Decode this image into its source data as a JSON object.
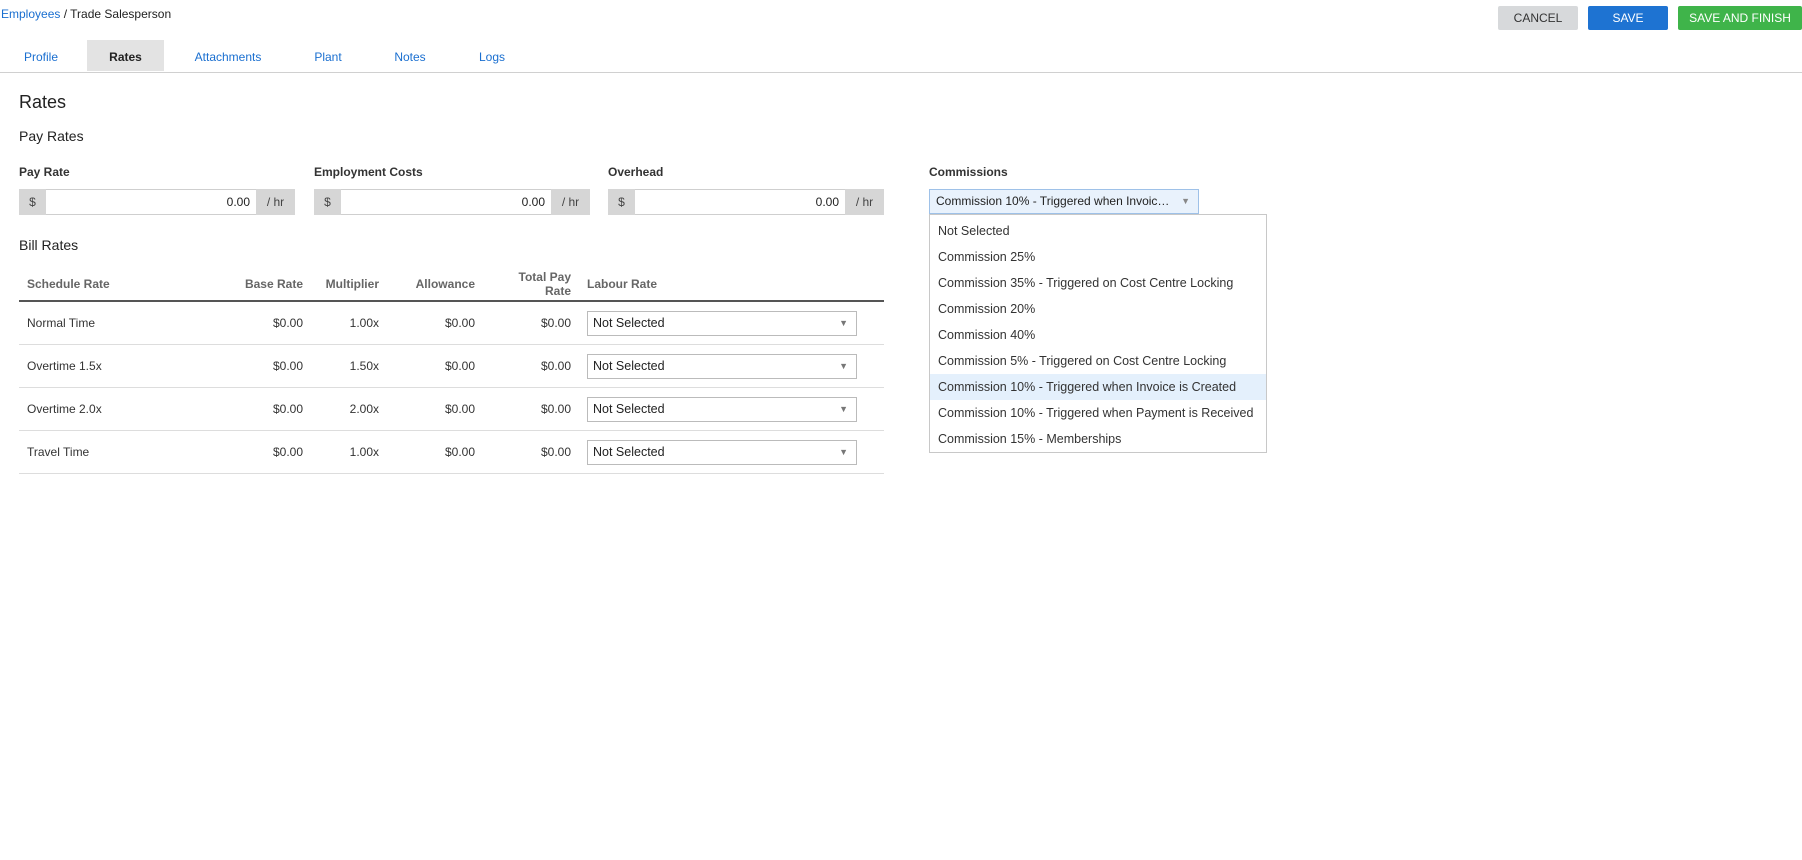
{
  "breadcrumb": {
    "parent": "Employees",
    "separator": " / ",
    "current": "Trade Salesperson"
  },
  "actions": {
    "cancel": "CANCEL",
    "save": "SAVE",
    "save_finish": "SAVE AND FINISH"
  },
  "tabs": [
    {
      "label": "Profile"
    },
    {
      "label": "Rates",
      "active": true
    },
    {
      "label": "Attachments"
    },
    {
      "label": "Plant"
    },
    {
      "label": "Notes"
    },
    {
      "label": "Logs"
    }
  ],
  "section_title": "Rates",
  "pay_rates": {
    "title": "Pay Rates",
    "fields": [
      {
        "label": "Pay Rate",
        "prefix": "$",
        "value": "0.00",
        "suffix": "/ hr"
      },
      {
        "label": "Employment Costs",
        "prefix": "$",
        "value": "0.00",
        "suffix": "/ hr"
      },
      {
        "label": "Overhead",
        "prefix": "$",
        "value": "0.00",
        "suffix": "/ hr"
      }
    ]
  },
  "commissions": {
    "label": "Commissions",
    "selected": "Commission 10% - Triggered when Invoic…",
    "options": [
      "Not Selected",
      "Commission 25%",
      "Commission 35% - Triggered on Cost Centre Locking",
      "Commission 20%",
      "Commission 40%",
      "Commission 5% - Triggered on Cost Centre Locking",
      "Commission 10% - Triggered when Invoice is Created",
      "Commission 10% - Triggered when Payment is Received",
      "Commission 15% - Memberships"
    ],
    "highlighted_option": "Commission 10% - Triggered when Invoice is Created"
  },
  "bill_rates": {
    "title": "Bill Rates",
    "columns": [
      "Schedule Rate",
      "Base Rate",
      "Multiplier",
      "Allowance",
      "Total Pay Rate",
      "Labour Rate"
    ],
    "rows": [
      {
        "schedule": "Normal Time",
        "base": "$0.00",
        "multiplier": "1.00x",
        "allowance": "$0.00",
        "total": "$0.00",
        "labour": "Not Selected"
      },
      {
        "schedule": "Overtime 1.5x",
        "base": "$0.00",
        "multiplier": "1.50x",
        "allowance": "$0.00",
        "total": "$0.00",
        "labour": "Not Selected"
      },
      {
        "schedule": "Overtime 2.0x",
        "base": "$0.00",
        "multiplier": "2.00x",
        "allowance": "$0.00",
        "total": "$0.00",
        "labour": "Not Selected"
      },
      {
        "schedule": "Travel Time",
        "base": "$0.00",
        "multiplier": "1.00x",
        "allowance": "$0.00",
        "total": "$0.00",
        "labour": "Not Selected"
      }
    ]
  },
  "icons": {
    "dropdown_arrow": "caret-down-icon"
  }
}
